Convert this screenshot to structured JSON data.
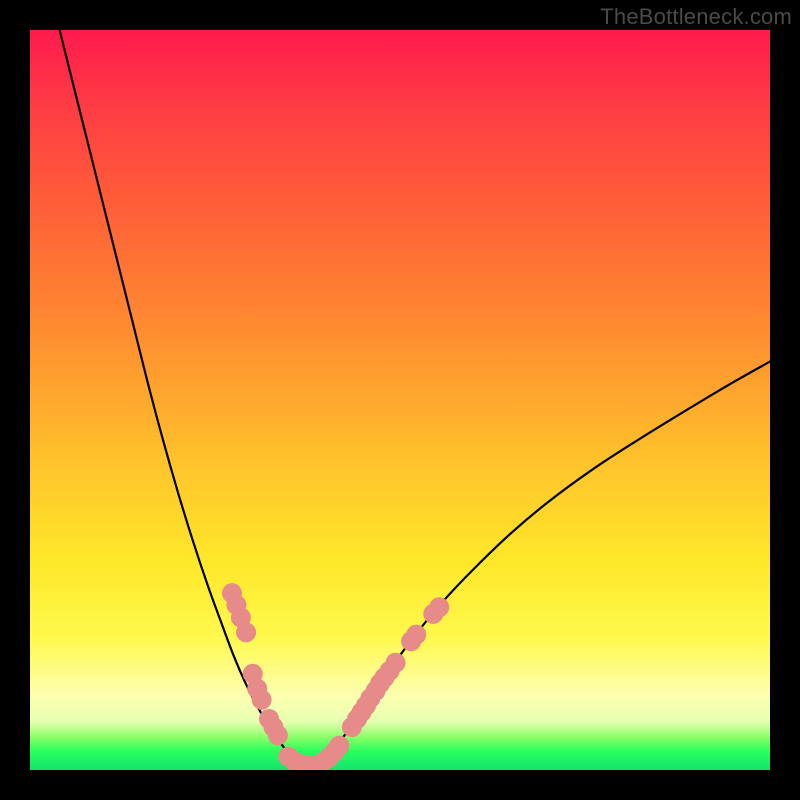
{
  "watermark": "TheBottleneck.com",
  "chart_data": {
    "type": "line",
    "title": "",
    "xlabel": "",
    "ylabel": "",
    "xlim": [
      0,
      100
    ],
    "ylim": [
      0,
      100
    ],
    "series": [
      {
        "name": "curve-left",
        "x": [
          4,
          6,
          8,
          10,
          12,
          14,
          16,
          18,
          20,
          22,
          24,
          26,
          27.5,
          29,
          30.5,
          32,
          33.5,
          34.5,
          35.5,
          36.2,
          36.8
        ],
        "values": [
          100,
          92,
          84,
          76,
          68,
          60,
          52,
          44.5,
          37.5,
          31,
          25,
          19.5,
          15.5,
          12,
          9,
          6.4,
          4.2,
          2.8,
          1.7,
          1.0,
          0.6
        ]
      },
      {
        "name": "curve-right",
        "x": [
          38.5,
          39.2,
          40,
          41,
          42.2,
          43.5,
          45,
          47,
          49.5,
          52.5,
          56,
          60,
          65,
          70,
          76,
          82,
          88,
          94,
          100
        ],
        "values": [
          0.6,
          1.1,
          1.9,
          2.9,
          4.3,
          6.0,
          8.2,
          11.2,
          14.8,
          18.8,
          23.0,
          27.2,
          32.0,
          36.2,
          40.6,
          44.5,
          48.2,
          51.8,
          55.2
        ]
      }
    ],
    "floor": {
      "name": "valley-floor",
      "x_start": 36.8,
      "x_end": 38.5,
      "value": 0.5
    },
    "markers": {
      "name": "salmon-dots",
      "color": "#e68a8a",
      "radius_px": 10,
      "points": [
        {
          "x": 27.3,
          "y": 23.9
        },
        {
          "x": 27.9,
          "y": 22.3
        },
        {
          "x": 28.5,
          "y": 20.6
        },
        {
          "x": 29.2,
          "y": 18.6
        },
        {
          "x": 30.1,
          "y": 13.0
        },
        {
          "x": 30.7,
          "y": 11.0
        },
        {
          "x": 31.3,
          "y": 9.5
        },
        {
          "x": 32.3,
          "y": 6.9
        },
        {
          "x": 32.9,
          "y": 5.8
        },
        {
          "x": 33.5,
          "y": 4.7
        },
        {
          "x": 34.9,
          "y": 1.8
        },
        {
          "x": 35.8,
          "y": 1.1
        },
        {
          "x": 36.6,
          "y": 0.8
        },
        {
          "x": 37.4,
          "y": 0.6
        },
        {
          "x": 38.4,
          "y": 0.6
        },
        {
          "x": 39.4,
          "y": 0.9
        },
        {
          "x": 40.3,
          "y": 1.6
        },
        {
          "x": 41.1,
          "y": 2.4
        },
        {
          "x": 41.8,
          "y": 3.3
        },
        {
          "x": 43.5,
          "y": 5.8
        },
        {
          "x": 44.2,
          "y": 6.9
        },
        {
          "x": 44.8,
          "y": 7.8
        },
        {
          "x": 45.4,
          "y": 8.7
        },
        {
          "x": 46.0,
          "y": 9.7
        },
        {
          "x": 46.7,
          "y": 10.7
        },
        {
          "x": 47.3,
          "y": 11.7
        },
        {
          "x": 47.9,
          "y": 12.5
        },
        {
          "x": 48.6,
          "y": 13.4
        },
        {
          "x": 49.4,
          "y": 14.5
        },
        {
          "x": 51.5,
          "y": 17.4
        },
        {
          "x": 52.2,
          "y": 18.3
        },
        {
          "x": 54.5,
          "y": 21.1
        },
        {
          "x": 55.3,
          "y": 22.0
        }
      ]
    }
  }
}
